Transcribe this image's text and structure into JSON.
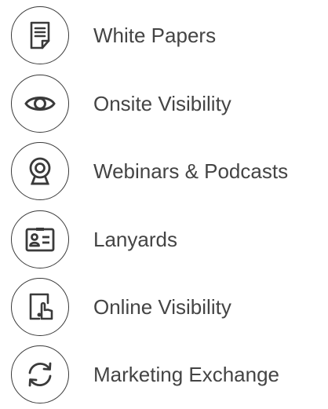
{
  "items": [
    {
      "label": "White Papers",
      "icon": "document-icon"
    },
    {
      "label": "Onsite Visibility",
      "icon": "eye-icon"
    },
    {
      "label": "Webinars & Podcasts",
      "icon": "webcam-icon"
    },
    {
      "label": "Lanyards",
      "icon": "id-badge-icon"
    },
    {
      "label": "Online Visibility",
      "icon": "tablet-touch-icon"
    },
    {
      "label": "Marketing Exchange",
      "icon": "sync-arrows-icon"
    }
  ],
  "colors": {
    "icon_stroke": "#3a3a3a",
    "text": "#444444",
    "background": "#ffffff"
  }
}
